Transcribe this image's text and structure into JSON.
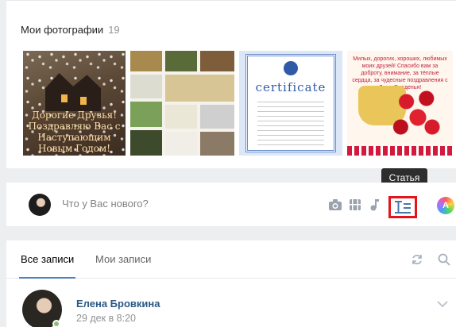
{
  "photos": {
    "title": "Мои фотографии",
    "count": "19",
    "photo1_text": "Дорогие Друзья! Поздравляю Вас с Наступающим Новым Годом!",
    "photo3_text": "certificate",
    "photo4_text": "Милых, дорогих, хороших, любимых моих друзей! Спасибо вам за доброту, внимание, за тёплые сердца, за чудесные поздравления с Днем Рожденья!"
  },
  "post_box": {
    "placeholder": "Что у Вас нового?",
    "tooltip": "Статья",
    "icons": [
      "camera-icon",
      "video-icon",
      "music-icon",
      "article-icon",
      "graffiti-icon"
    ]
  },
  "feed": {
    "tabs": [
      {
        "label": "Все записи",
        "active": true
      },
      {
        "label": "Мои записи",
        "active": false
      }
    ],
    "post": {
      "author": "Елена Бровкина",
      "date": "29 дек в 8:20"
    }
  },
  "colors": {
    "accent": "#5181b8",
    "link": "#2a5885",
    "highlight_border": "#e3141a"
  }
}
